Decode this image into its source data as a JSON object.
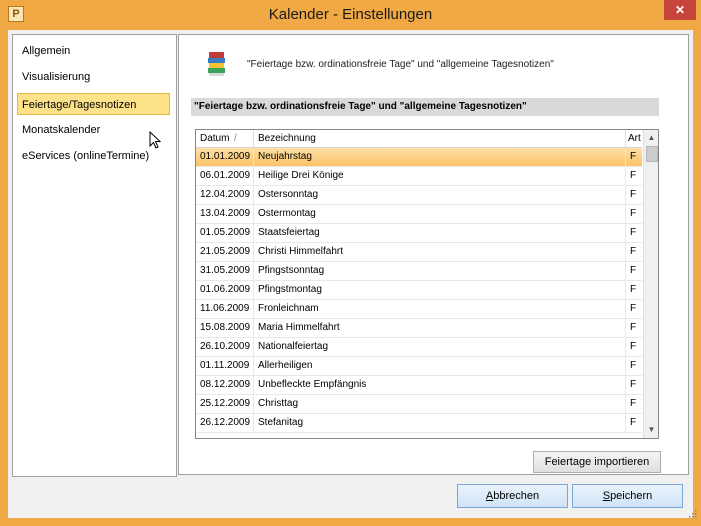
{
  "window": {
    "title": "Kalender - Einstellungen",
    "app_icon_letter": "P",
    "close_glyph": "✕"
  },
  "sidebar": {
    "items": [
      {
        "label": "Allgemein",
        "selected": false
      },
      {
        "label": "Visualisierung",
        "selected": false
      },
      {
        "label": "Feiertage/Tagesnotizen",
        "selected": true
      },
      {
        "label": "Monatskalender",
        "selected": false
      },
      {
        "label": "eServices (onlineTermine)",
        "selected": false
      }
    ]
  },
  "panel": {
    "header_text": "\"Feiertage bzw. ordinationsfreie Tage\" und \"allgemeine Tagesnotizen\"",
    "section_title": "\"Feiertage bzw. ordinationsfreie Tage\" und \"allgemeine Tagesnotizen\"",
    "header_icon": "books-icon",
    "table": {
      "columns": {
        "date": "Datum",
        "name": "Bezeichnung",
        "art": "Art"
      },
      "sort_indicator": "/",
      "rows": [
        {
          "date": "01.01.2009",
          "name": "Neujahrstag",
          "art": "F",
          "selected": true
        },
        {
          "date": "06.01.2009",
          "name": "Heilige Drei Könige",
          "art": "F"
        },
        {
          "date": "12.04.2009",
          "name": "Ostersonntag",
          "art": "F"
        },
        {
          "date": "13.04.2009",
          "name": "Ostermontag",
          "art": "F"
        },
        {
          "date": "01.05.2009",
          "name": "Staatsfeiertag",
          "art": "F"
        },
        {
          "date": "21.05.2009",
          "name": "Christi Himmelfahrt",
          "art": "F"
        },
        {
          "date": "31.05.2009",
          "name": "Pfingstsonntag",
          "art": "F"
        },
        {
          "date": "01.06.2009",
          "name": "Pfingstmontag",
          "art": "F"
        },
        {
          "date": "11.06.2009",
          "name": "Fronleichnam",
          "art": "F"
        },
        {
          "date": "15.08.2009",
          "name": "Maria Himmelfahrt",
          "art": "F"
        },
        {
          "date": "26.10.2009",
          "name": "Nationalfeiertag",
          "art": "F"
        },
        {
          "date": "01.11.2009",
          "name": "Allerheiligen",
          "art": "F"
        },
        {
          "date": "08.12.2009",
          "name": "Unbefleckte Empfängnis",
          "art": "F"
        },
        {
          "date": "25.12.2009",
          "name": "Christtag",
          "art": "F"
        },
        {
          "date": "26.12.2009",
          "name": "Stefanitag",
          "art": "F"
        }
      ]
    },
    "import_button": "Feiertage importieren"
  },
  "footer": {
    "cancel_prefix": "",
    "cancel_accel": "A",
    "cancel_rest": "bbrechen",
    "save_accel": "S",
    "save_rest": "peichern"
  },
  "colors": {
    "frame": "#f0a944",
    "selection": "#fde28a",
    "row_selection": "#fbc266",
    "close_button": "#c7453a"
  }
}
